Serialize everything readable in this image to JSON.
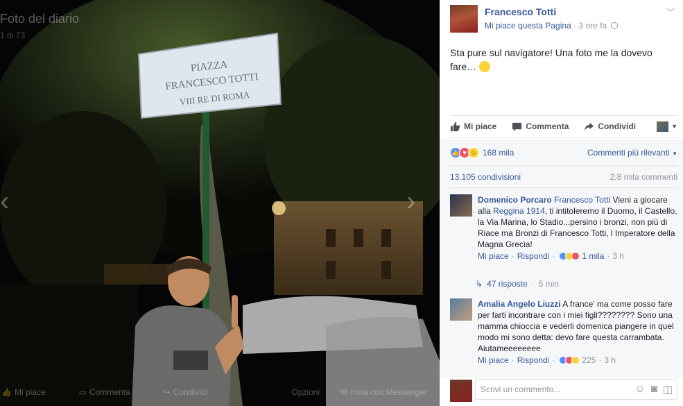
{
  "viewer": {
    "album_title": "Foto del diario",
    "album_sub": "1 di 73",
    "sign_line1": "PIAZZA",
    "sign_line2": "FRANCESCO TOTTI",
    "sign_line3": "VIII RE DI ROMA",
    "bottom_like": "Mi piace",
    "bottom_comment": "Commenta",
    "bottom_share": "Condividi",
    "bottom_options": "Opzioni",
    "bottom_messenger": "Invia con Messenger"
  },
  "post": {
    "author": "Francesco Totti",
    "like_page": "Mi piace questa Pagina",
    "separator": "·",
    "time": "3 ore fa",
    "text": "Sta pure sul navigatore! Una foto me la dovevo fare… ",
    "like_label": "Mi piace",
    "comment_label": "Commenta",
    "share_label": "Condividi",
    "reactions_count": "168 mila",
    "sort_label": "Commenti più rilevanti",
    "shares": "13.105 condivisioni",
    "comments_count": "2,8 mila commenti"
  },
  "comments": [
    {
      "author": "Domenico Porcaro",
      "tag": "Francesco Totti",
      "text_a": " Vieni a giocare alla ",
      "link": "Reggina 1914",
      "text_b": ", ti intitoleremo il Duomo, il Castello, la Via Marina, lo Stadio...persino i bronzi, non più di Riace ma Bronzi di Francesco Totti, l Imperatore della Magna Grecia!",
      "like": "Mi piace",
      "reply": "Rispondi",
      "reactions": "1 mila",
      "age": "3 h"
    },
    {
      "author": "Amalia Angelo Liuzzi",
      "text": " A france' ma come posso fare per farti incontrare con i miei figli???????? Sono una mamma chioccia e vederli domenica piangere in quel modo mi sono detta: devo fare questa carrambata. Aiutameeeeeeee",
      "like": "Mi piace",
      "reply": "Rispondi",
      "reactions": "225",
      "age": "3 h"
    }
  ],
  "replies": {
    "count": "47 risposte",
    "separator": "·",
    "age": "5 min"
  },
  "composer": {
    "placeholder": "Scrivi un commento..."
  }
}
